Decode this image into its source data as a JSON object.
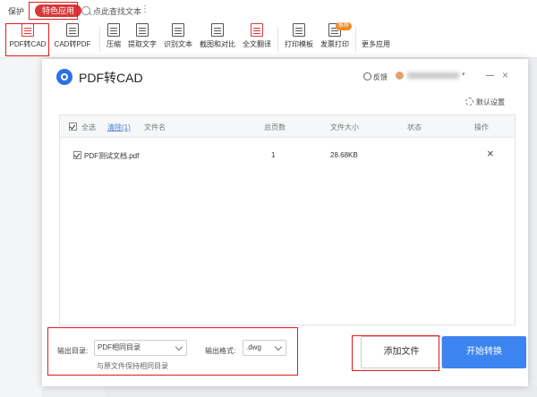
{
  "topbar": {
    "tab_protect": "保护",
    "tab_special": "特色应用",
    "search": "点此查找文本",
    "more": "⋮"
  },
  "ribbon": {
    "items": [
      {
        "label": "PDF转CAD"
      },
      {
        "label": "CAD转PDF"
      },
      {
        "label": "压缩"
      },
      {
        "label": "提取文字"
      },
      {
        "label": "识别文本"
      },
      {
        "label": "截图和对比"
      },
      {
        "label": "全文翻译"
      },
      {
        "label": "打印模板"
      },
      {
        "label": "发票打印"
      },
      {
        "label": "更多应用"
      }
    ],
    "badge": "推荐"
  },
  "dialog": {
    "title": "PDF转CAD",
    "feedback": "反馈",
    "settings": "默认设置",
    "close": "×",
    "table": {
      "headers": {
        "select_all": "全选",
        "clear": "清除(1)",
        "filename": "文件名",
        "pages": "总页数",
        "size": "文件大小",
        "status": "状态",
        "action": "操作"
      },
      "rows": [
        {
          "filename": "PDF测试文档.pdf",
          "pages": "1",
          "size": "28.68KB",
          "status": "",
          "action": "×"
        }
      ]
    },
    "output": {
      "dir_label": "输出目录:",
      "dir_value": "PDF相同目录",
      "format_label": "输出格式:",
      "format_value": ".dwg",
      "hint": "与原文件保持相同目录"
    },
    "buttons": {
      "add_file": "添加文件",
      "start": "开始转换"
    }
  },
  "colors": {
    "accent": "#3c84f0",
    "brand_red": "#d9383a",
    "highlight_box": "#e21b1b"
  }
}
